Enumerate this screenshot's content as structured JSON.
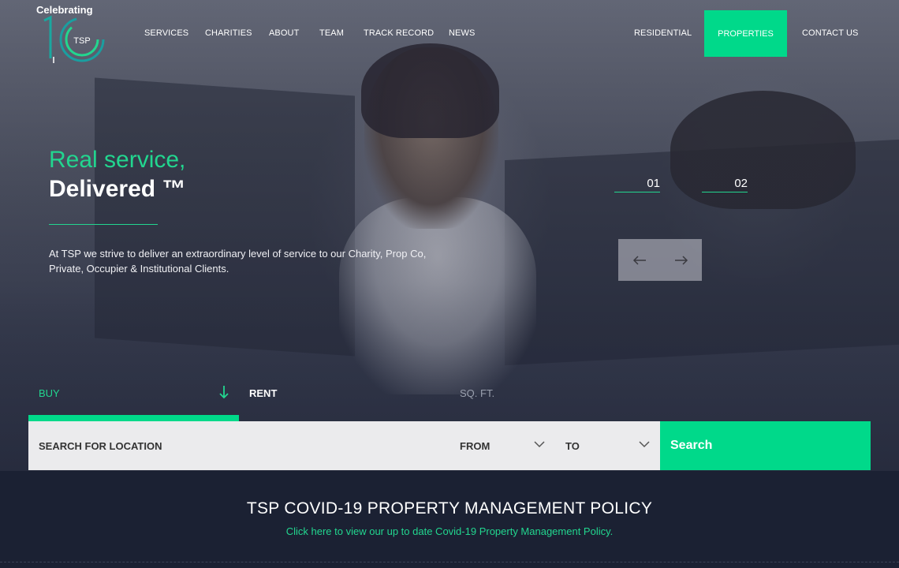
{
  "logo": {
    "badge_text": "Celebrating",
    "ring_text": "TSP",
    "icon": "tsp-10-logo"
  },
  "nav": {
    "items": [
      "SERVICES",
      "CHARITIES",
      "ABOUT",
      "TEAM",
      "TRACK RECORD",
      "NEWS"
    ],
    "right_items": [
      "RESIDENTIAL",
      "PROPERTIES",
      "CONTACT US"
    ],
    "active": "PROPERTIES"
  },
  "hero": {
    "headline_line1": "Real service,",
    "headline_line2": "Delivered ™",
    "intro": "At TSP we strive to deliver an extraordinary level of service to our Charity, Prop Co, Private, Occupier & Institutional Clients.",
    "slides": [
      "01",
      "02"
    ],
    "prev_icon": "arrow-left-icon",
    "next_icon": "arrow-right-icon"
  },
  "search": {
    "tabs": [
      "BUY",
      "RENT",
      "SQ. FT."
    ],
    "active_tab": "BUY",
    "location_placeholder": "SEARCH FOR LOCATION",
    "from_label": "FROM",
    "to_label": "TO",
    "search_button": "Search"
  },
  "covid": {
    "title": "TSP COVID-19 PROPERTY MANAGEMENT POLICY",
    "link": "Click here to view our up to date Covid-19 Property Management Policy."
  },
  "colors": {
    "accent": "#00d98a",
    "accent_text": "#22d68f",
    "dark_band": "#1b2133",
    "search_bg": "#ebebed"
  }
}
